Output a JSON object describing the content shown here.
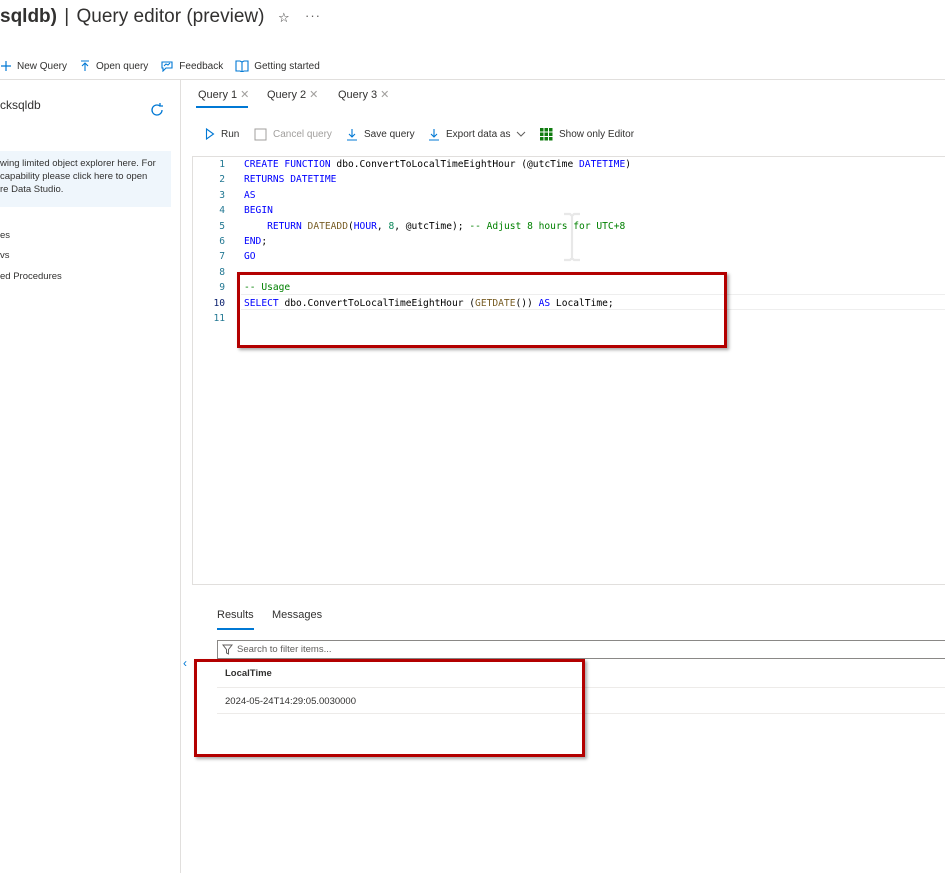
{
  "header": {
    "title_db": "sqldb)",
    "title_separator": "|",
    "title_main": "Query editor (preview)",
    "favorite_icon": "star-icon",
    "more_label": "···"
  },
  "toolbar": {
    "new_query": "New Query",
    "open_query": "Open query",
    "feedback": "Feedback",
    "getting_started": "Getting started"
  },
  "sidebar": {
    "db_name": "cksqldb",
    "info_lines": [
      "wing limited object explorer here. For",
      "capability please click here to open",
      "re Data Studio."
    ],
    "tree": [
      "es",
      "vs",
      "ed Procedures"
    ]
  },
  "query_tabs": [
    {
      "label": "Query 1",
      "active": true
    },
    {
      "label": "Query 2",
      "active": false
    },
    {
      "label": "Query 3",
      "active": false
    }
  ],
  "query_toolbar": {
    "run": "Run",
    "cancel": "Cancel query",
    "save": "Save query",
    "export": "Export data as",
    "show_only_editor": "Show only Editor"
  },
  "editor": {
    "line_numbers": [
      "1",
      "2",
      "3",
      "4",
      "5",
      "6",
      "7",
      "8",
      "9",
      "10",
      "11"
    ],
    "current_line": "10",
    "lines": [
      [
        {
          "t": "kw",
          "v": "CREATE FUNCTION "
        },
        {
          "t": "pl",
          "v": "dbo.ConvertToLocalTimeEightHour (@utcTime "
        },
        {
          "t": "ty",
          "v": "DATETIME"
        },
        {
          "t": "pl",
          "v": ")"
        }
      ],
      [
        {
          "t": "kw",
          "v": "RETURNS DATETIME"
        }
      ],
      [
        {
          "t": "kw",
          "v": "AS"
        }
      ],
      [
        {
          "t": "kw",
          "v": "BEGIN"
        }
      ],
      [
        {
          "t": "pl",
          "v": "    "
        },
        {
          "t": "kw",
          "v": "RETURN "
        },
        {
          "t": "fn",
          "v": "DATEADD"
        },
        {
          "t": "pl",
          "v": "("
        },
        {
          "t": "kw",
          "v": "HOUR"
        },
        {
          "t": "pl",
          "v": ", "
        },
        {
          "t": "num",
          "v": "8"
        },
        {
          "t": "pl",
          "v": ", @utcTime); "
        },
        {
          "t": "cm",
          "v": "-- Adjust 8 hours for UTC+8"
        }
      ],
      [
        {
          "t": "kw",
          "v": "END"
        },
        {
          "t": "pl",
          "v": ";"
        }
      ],
      [
        {
          "t": "kw",
          "v": "GO"
        }
      ],
      [],
      [
        {
          "t": "cm",
          "v": "-- Usage"
        }
      ],
      [
        {
          "t": "kw",
          "v": "SELECT "
        },
        {
          "t": "pl",
          "v": "dbo.ConvertToLocalTimeEightHour ("
        },
        {
          "t": "fn",
          "v": "GETDATE"
        },
        {
          "t": "pl",
          "v": "()) "
        },
        {
          "t": "kw",
          "v": "AS "
        },
        {
          "t": "pl",
          "v": "LocalTime;"
        }
      ],
      []
    ]
  },
  "results": {
    "tabs": [
      "Results",
      "Messages"
    ],
    "filter_placeholder": "Search to filter items...",
    "columns": [
      "LocalTime"
    ],
    "rows": [
      [
        "2024-05-24T14:29:05.0030000"
      ]
    ]
  },
  "colors": {
    "accent": "#0078d4",
    "highlight_box": "#b30000"
  }
}
